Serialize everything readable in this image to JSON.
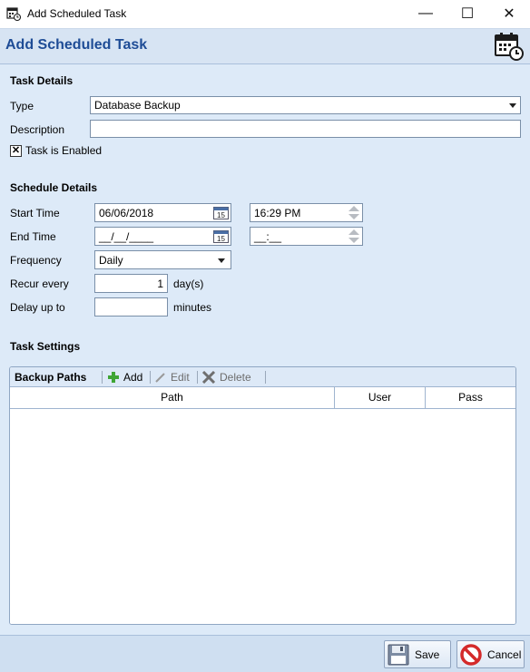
{
  "window": {
    "title": "Add Scheduled Task",
    "minimize": "—",
    "maximize": "☐",
    "close": "✕"
  },
  "header": {
    "title": "Add Scheduled Task"
  },
  "task_details": {
    "section_label": "Task Details",
    "type_label": "Type",
    "type_value": "Database Backup",
    "description_label": "Description",
    "description_value": "",
    "enabled_label": "Task is Enabled",
    "enabled_checked": true
  },
  "schedule_details": {
    "section_label": "Schedule Details",
    "start_time_label": "Start Time",
    "start_date": "06/06/2018",
    "start_time": "16:29  PM",
    "end_time_label": "End Time",
    "end_date": "__/__/____",
    "end_time": "__:__",
    "frequency_label": "Frequency",
    "frequency_value": "Daily",
    "recur_label": "Recur every",
    "recur_value": "1",
    "recur_unit": "day(s)",
    "delay_label": "Delay up to",
    "delay_value": "",
    "delay_unit": "minutes"
  },
  "task_settings": {
    "section_label": "Task Settings",
    "grid_title": "Backup Paths",
    "add_label": "Add",
    "edit_label": "Edit",
    "delete_label": "Delete",
    "columns": [
      "Path",
      "User",
      "Pass"
    ],
    "rows": []
  },
  "footer": {
    "save_label": "Save",
    "cancel_label": "Cancel"
  },
  "colors": {
    "header_title": "#1e4c96",
    "content_bg": "#ddeaf8",
    "add_icon": "#3fa535",
    "cancel_icon": "#d42a2a"
  }
}
